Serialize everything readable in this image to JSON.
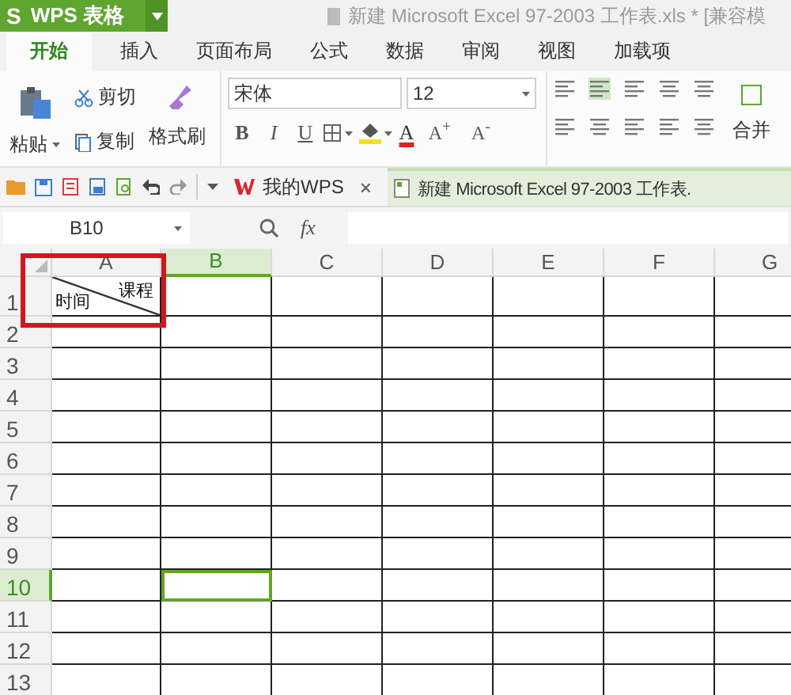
{
  "app_button": {
    "logo": "S",
    "label": "WPS 表格"
  },
  "title": "新建 Microsoft Excel 97-2003 工作表.xls * [兼容模",
  "tabs": [
    {
      "label": "开始",
      "selected": true
    },
    {
      "label": "插入",
      "selected": false
    },
    {
      "label": "页面布局",
      "selected": false
    },
    {
      "label": "公式",
      "selected": false
    },
    {
      "label": "数据",
      "selected": false
    },
    {
      "label": "审阅",
      "selected": false
    },
    {
      "label": "视图",
      "selected": false
    },
    {
      "label": "加载项",
      "selected": false
    }
  ],
  "clipboard": {
    "paste": "粘贴",
    "cut": "剪切",
    "copy": "复制",
    "format_painter": "格式刷"
  },
  "font": {
    "name": "宋体",
    "size": "12",
    "grow": "A$^{+}$",
    "shrink": "A$^{-}$",
    "bold": "B",
    "italic": "I",
    "underline": "U",
    "font_color": "A"
  },
  "merge": "合并",
  "doc_tabs": [
    {
      "label": "我的WPS",
      "close": "×",
      "selected": false
    },
    {
      "label": "新建 Microsoft Excel 97-2003 工作表.",
      "selected": true
    }
  ],
  "name_box": "B10",
  "fx": "fx",
  "sheet": {
    "columns": [
      {
        "label": "A",
        "selected": false
      },
      {
        "label": "B",
        "selected": true
      },
      {
        "label": "C",
        "selected": false
      },
      {
        "label": "D",
        "selected": false
      },
      {
        "label": "E",
        "selected": false
      },
      {
        "label": "F",
        "selected": false
      },
      {
        "label": "G",
        "selected": false
      }
    ],
    "rows": [
      {
        "label": "1",
        "selected": false
      },
      {
        "label": "2",
        "selected": false
      },
      {
        "label": "3",
        "selected": false
      },
      {
        "label": "4",
        "selected": false
      },
      {
        "label": "5",
        "selected": false
      },
      {
        "label": "6",
        "selected": false
      },
      {
        "label": "7",
        "selected": false
      },
      {
        "label": "8",
        "selected": false
      },
      {
        "label": "9",
        "selected": false
      },
      {
        "label": "10",
        "selected": true
      },
      {
        "label": "11",
        "selected": false
      },
      {
        "label": "12",
        "selected": false
      },
      {
        "label": "13",
        "selected": false
      }
    ],
    "split_cell": {
      "top_right": "课程",
      "bottom_left": "时间"
    },
    "annotation_frame": true
  }
}
